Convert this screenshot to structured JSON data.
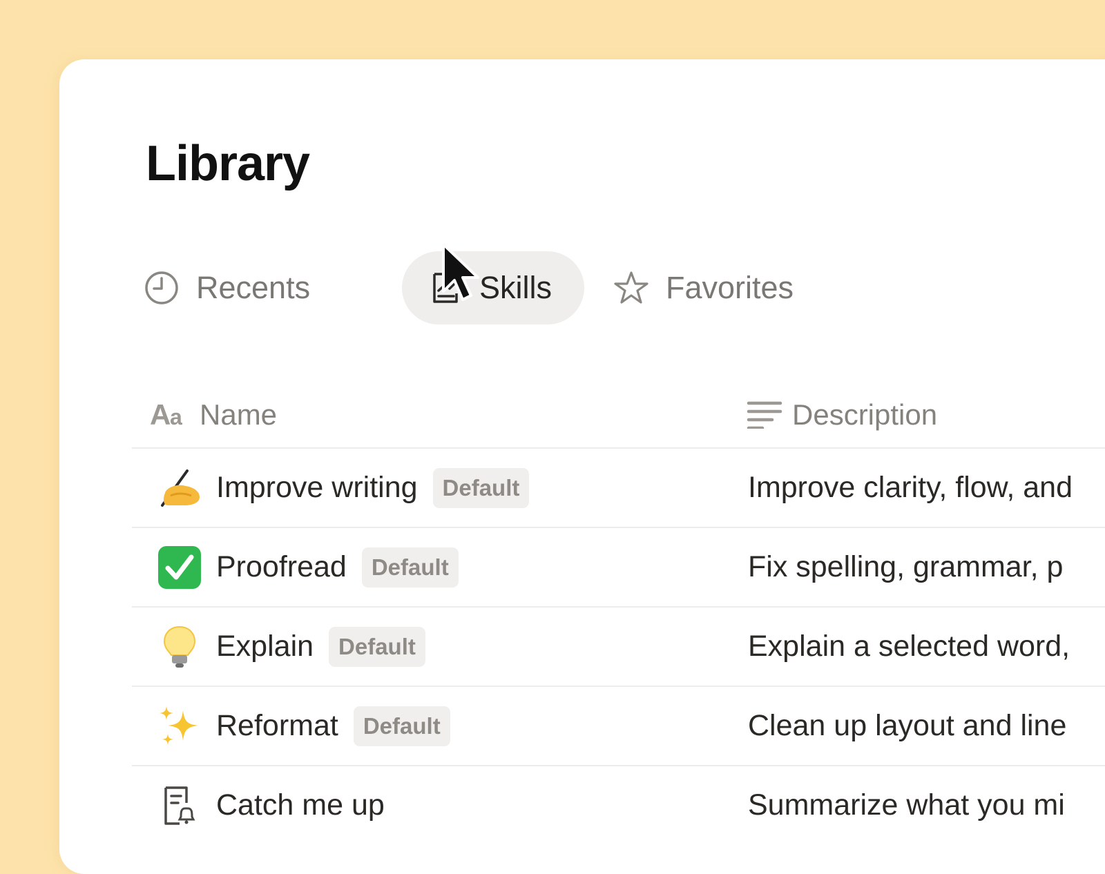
{
  "page": {
    "title": "Library"
  },
  "tabs": [
    {
      "label": "Recents",
      "icon": "clock-icon",
      "active": false
    },
    {
      "label": "Skills",
      "icon": "skills-chart-icon",
      "active": true
    },
    {
      "label": "Favorites",
      "icon": "star-icon",
      "active": false
    }
  ],
  "table": {
    "columns": [
      {
        "label": "Name",
        "icon": "text-aa-icon"
      },
      {
        "label": "Description",
        "icon": "lines-icon"
      }
    ],
    "rows": [
      {
        "icon": "writing-hand-icon",
        "name": "Improve writing",
        "badge": "Default",
        "description": "Improve clarity, flow, and"
      },
      {
        "icon": "check-mark-icon",
        "name": "Proofread",
        "badge": "Default",
        "description": "Fix spelling, grammar, p"
      },
      {
        "icon": "lightbulb-icon",
        "name": "Explain",
        "badge": "Default",
        "description": "Explain a selected word,"
      },
      {
        "icon": "sparkles-icon",
        "name": "Reformat",
        "badge": "Default",
        "description": "Clean up layout and line"
      },
      {
        "icon": "document-bell-icon",
        "name": "Catch me up",
        "badge": "",
        "description": "Summarize what you mi"
      }
    ]
  },
  "colors": {
    "background": "#fde3ab",
    "panel": "#ffffff",
    "active_tab": "#efeeec",
    "badge_bg": "#f0efed",
    "check_green": "#2fb84f"
  }
}
